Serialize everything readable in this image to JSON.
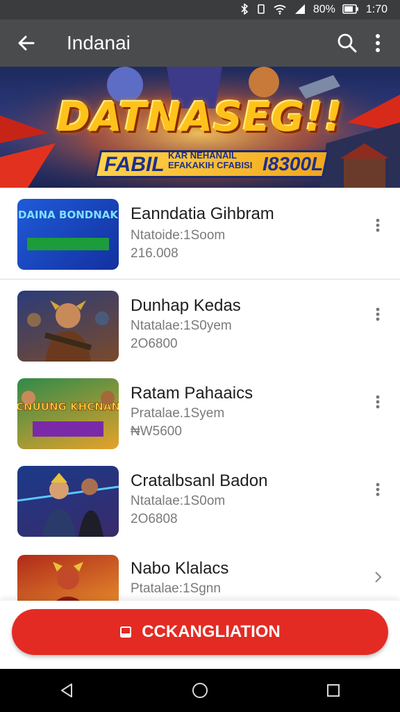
{
  "status_bar": {
    "battery": "80%",
    "time": "1:70"
  },
  "app_bar": {
    "title": "Indanai"
  },
  "banner": {
    "headline": "DATNASEG!!",
    "left_text": "FABIL",
    "middle_text": "KAR NEHANAIL EFAKAKIH CFABISI",
    "right_text": "I8300L"
  },
  "list": {
    "items": [
      {
        "thumb_text": "DAINA BONDNAK",
        "name": "Eanndatia Gihbram",
        "meta": "Ntatoide:1Soom",
        "count": "216.008",
        "more_icon": "more-vert-icon"
      },
      {
        "name": "Dunhap Kedas",
        "meta": "Ntatalae:1S0yem",
        "count": "2O6800",
        "more_icon": "more-vert-icon"
      },
      {
        "thumb_text": "CNUUNG KHCNAN",
        "name": "Ratam Pahaaics",
        "meta": "Pratalae.1Syem",
        "count": "₦W5600",
        "more_icon": "more-vert-icon"
      },
      {
        "name": "Cratalbsanl Badon",
        "meta": "Ntatalae:1S0om",
        "count": "2O6808",
        "more_icon": "more-vert-icon"
      },
      {
        "name": "Nabo Klalacs",
        "meta": "Ptatalae:1Sgnn",
        "count": "",
        "more_icon": "chevron-right-icon"
      }
    ]
  },
  "cta": {
    "label": "CCKANGLIATION"
  },
  "colors": {
    "accent": "#e32b24",
    "appbar": "#4a4b4d",
    "statusbar": "#3b3c3e"
  }
}
